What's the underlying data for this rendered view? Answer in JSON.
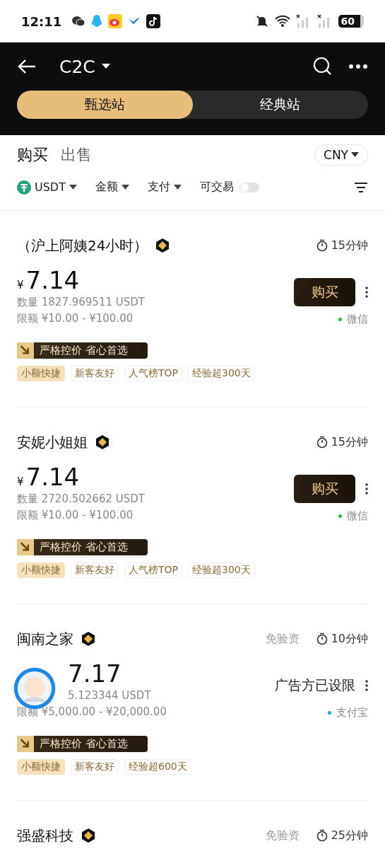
{
  "status_bar": {
    "time": "12:11",
    "battery": "60"
  },
  "header": {
    "title": "C2C",
    "tabs": [
      {
        "label": "甄选站",
        "selected": true
      },
      {
        "label": "经典站",
        "selected": false
      }
    ]
  },
  "trade_tabs": [
    {
      "label": "购买",
      "selected": true
    },
    {
      "label": "出售",
      "selected": false
    }
  ],
  "currency": "CNY",
  "filters": [
    {
      "kind": "coin",
      "label": "USDT"
    },
    {
      "kind": "dropdown",
      "label": "金额"
    },
    {
      "kind": "dropdown",
      "label": "支付"
    },
    {
      "kind": "toggle",
      "label": "可交易",
      "on": false
    }
  ],
  "listings": [
    {
      "name": "（沪上阿姨24小时）",
      "time": "15分钟",
      "currency_symbol": "¥",
      "price": "7.14",
      "quantity": "数量 1827.969511 USDT",
      "limit": "限额 ¥10.00 - ¥100.00",
      "action": {
        "kind": "button",
        "label": "购买"
      },
      "payment": {
        "label": "微信",
        "color": "#2bc23b"
      },
      "promo": "严格控价 省心首选",
      "tags": [
        {
          "label": "小额快捷",
          "highlighted": true
        },
        {
          "label": "新客友好",
          "highlighted": false
        },
        {
          "label": "人气榜TOP",
          "highlighted": false
        },
        {
          "label": "经验超300天",
          "highlighted": false
        }
      ]
    },
    {
      "name": "安妮小姐姐",
      "time": "15分钟",
      "currency_symbol": "¥",
      "price": "7.14",
      "quantity": "数量 2720.502662 USDT",
      "limit": "限额 ¥10.00 - ¥100.00",
      "action": {
        "kind": "button",
        "label": "购买"
      },
      "payment": {
        "label": "微信",
        "color": "#2bc23b"
      },
      "promo": "严格控价 省心首选",
      "tags": [
        {
          "label": "小额快捷",
          "highlighted": true
        },
        {
          "label": "新客友好",
          "highlighted": false
        },
        {
          "label": "人气榜TOP",
          "highlighted": false
        },
        {
          "label": "经验超300天",
          "highlighted": false
        }
      ]
    },
    {
      "name": "闽南之家",
      "note": "免验资",
      "time": "10分钟",
      "price": "7.17",
      "quantity": "5.123344 USDT",
      "limit": "限额 ¥5,000.00 - ¥20,000.00",
      "action": {
        "kind": "notice",
        "label": "广告方已设限"
      },
      "payment": {
        "label": "支付宝",
        "color": "#1a9fe0"
      },
      "promo": "严格控价 省心首选",
      "tags": [
        {
          "label": "小额快捷",
          "highlighted": true
        },
        {
          "label": "新客友好",
          "highlighted": false
        },
        {
          "label": "经验超600天",
          "highlighted": false
        }
      ]
    },
    {
      "name": "强盛科技",
      "note": "免验资",
      "time": "25分钟"
    }
  ]
}
